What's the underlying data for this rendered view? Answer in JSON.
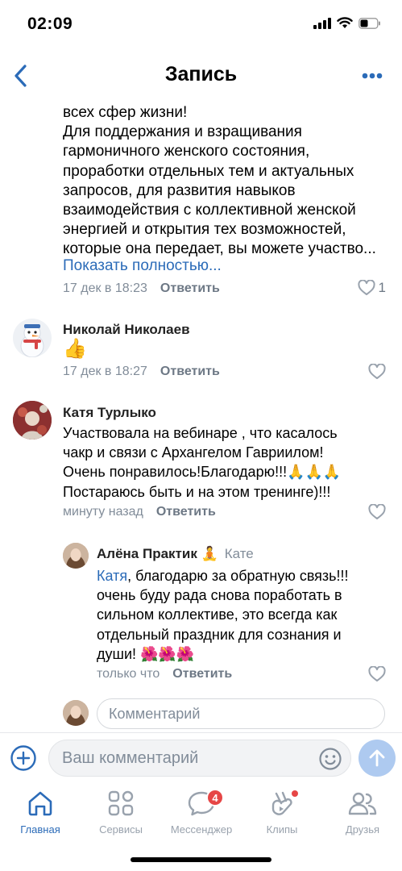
{
  "status": {
    "time": "02:09"
  },
  "nav": {
    "title": "Запись"
  },
  "post": {
    "lines": [
      "всех сфер жизни!",
      "Для поддержания и взращивания",
      "гармоничного женского состояния,",
      "проработки отдельных тем и актуальных",
      "запросов, для развития навыков",
      "взаимодействия с коллективной женской",
      "энергией и открытия тех возможностей,",
      "которые она передает, вы можете участво..."
    ],
    "show_more": "Показать полностью...",
    "time": "17 дек в 18:23",
    "reply_label": "Ответить",
    "likes": "1"
  },
  "comments": [
    {
      "author": "Николай Николаев",
      "text": "👍",
      "time": "17 дек в 18:27",
      "reply_label": "Ответить"
    },
    {
      "author": "Катя Турлыко",
      "lines": [
        "Участвовала на вебинаре , что касалось",
        "чакр и связи с Архангелом Гавриилом!",
        "Очень понравилось!Благодарю!!!🙏🙏🙏",
        "Постараюсь быть и на этом тренинге)!!!"
      ],
      "time": "минуту назад",
      "reply_label": "Ответить"
    }
  ],
  "reply": {
    "author": "Алёна Практик 🧘",
    "reply_to": "Кате",
    "mention": "Катя",
    "first_line_rest": ", благодарю за обратную связь!!!",
    "lines": [
      "очень буду рада снова поработать в",
      "сильном коллективе, это всегда как",
      "отдельный праздник для сознания и",
      "души! 🌺🌺🌺"
    ],
    "time": "только что",
    "reply_label": "Ответить"
  },
  "thread_input": {
    "placeholder": "Комментарий"
  },
  "composer": {
    "placeholder": "Ваш комментарий"
  },
  "tabs": [
    {
      "label": "Главная",
      "icon": "home-icon",
      "active": true
    },
    {
      "label": "Сервисы",
      "icon": "services-icon"
    },
    {
      "label": "Мессенджер",
      "icon": "messenger-icon",
      "badge": "4"
    },
    {
      "label": "Клипы",
      "icon": "clips-icon",
      "dot": true
    },
    {
      "label": "Друзья",
      "icon": "friends-icon"
    }
  ],
  "colors": {
    "accent": "#2b6bb8",
    "secondary_text": "#818c99",
    "badge": "#e64646"
  }
}
